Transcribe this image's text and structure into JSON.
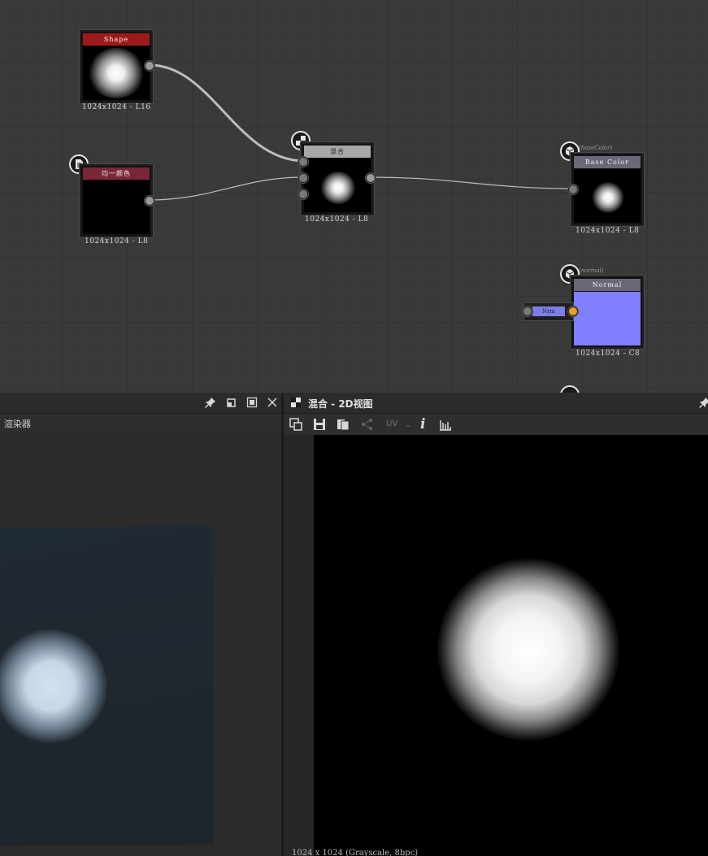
{
  "graph": {
    "nodes": {
      "shape": {
        "title": "Shape",
        "caption": "1024x1024 - L16"
      },
      "uniform_color": {
        "title": "均一颜色",
        "caption": "1024x1024 - L8"
      },
      "blend": {
        "title": "混合",
        "caption": "1024x1024 - L8"
      },
      "base_color": {
        "tag": "(baseColor)",
        "title": "Base Color",
        "caption": "1024x1024 - L8"
      },
      "normal": {
        "tag": "(normal)",
        "title": "Normal",
        "caption": "1024x1024 - C8"
      },
      "normal_input": {
        "label": "Nrm"
      }
    },
    "colors": {
      "shape_header": "#9e1a1a",
      "uniform_header": "#7a2638",
      "blend_header": "#a8a8a8",
      "output_header": "#686878",
      "normal_fill": "#8080ff"
    }
  },
  "left_panel": {
    "title": "渲染器",
    "icons": [
      "pin-icon",
      "float-icon",
      "maximize-icon",
      "close-icon"
    ]
  },
  "right_panel": {
    "title": "混合 - 2D视图",
    "uv_label": "UV",
    "info_label": "i",
    "status": "1024 x 1024 (Grayscale, 8bpc)"
  }
}
